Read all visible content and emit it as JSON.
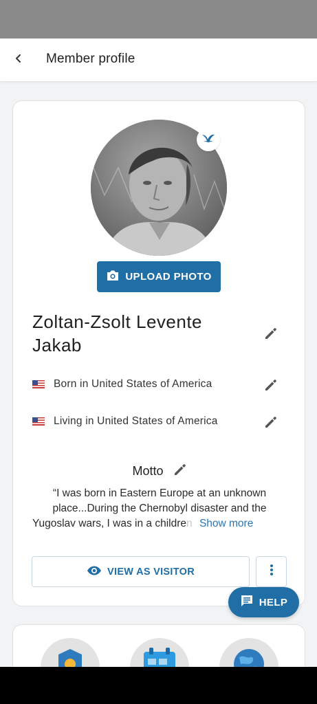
{
  "header": {
    "title": "Member profile",
    "back_icon": "chevron-left-icon"
  },
  "profile": {
    "name": "Zoltan-Zsolt Levente Jakab",
    "badge_icon": "bird-icon",
    "upload_label": "UPLOAD PHOTO",
    "born": "Born in United States of America",
    "living": "Living in United States of America",
    "flag_icon": "us-flag-icon"
  },
  "motto": {
    "label": "Motto",
    "text": "“I was born in Eastern Europe at an unknown place...During the Chernobyl disaster and the",
    "last_line": "Yugoslav wars, I was in a childre",
    "fade_text": "n",
    "show_more": "Show more"
  },
  "actions": {
    "view_as_visitor": "VIEW AS VISITOR",
    "help": "HELP"
  },
  "stats_icons": [
    "badge-icon",
    "calendar-icon",
    "globe-icon"
  ],
  "colors": {
    "accent": "#1f6ea6",
    "link": "#2b76b2",
    "status_bar": "#8a8a8a"
  }
}
